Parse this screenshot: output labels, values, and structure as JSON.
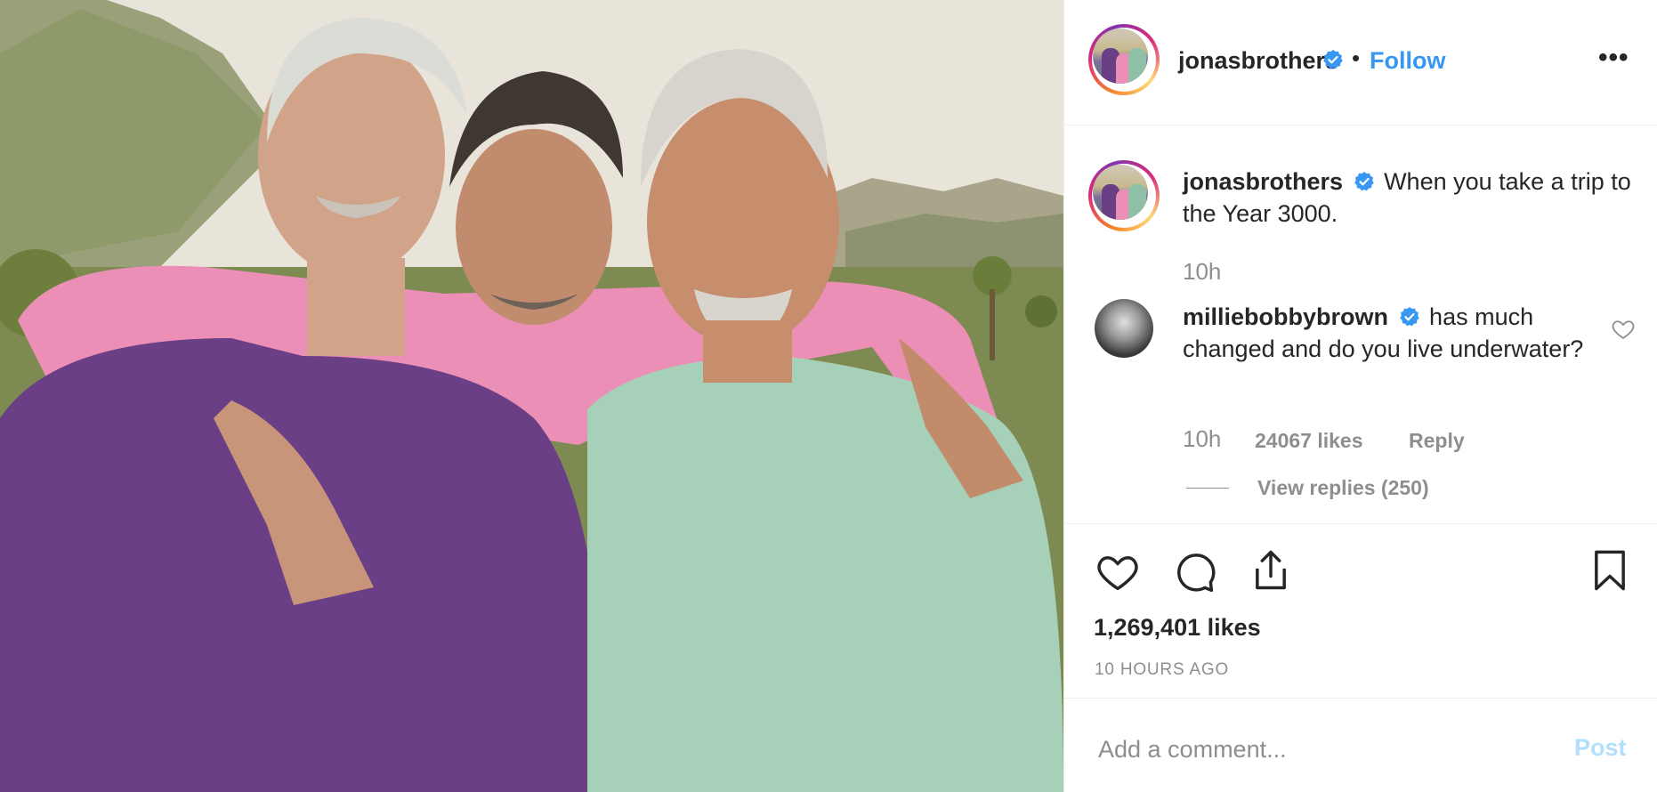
{
  "post": {
    "photo_alt": "Three men in sweaters outdoors",
    "header": {
      "username": "jonasbrothers",
      "separator": "•",
      "follow_label": "Follow",
      "more_label": "•••"
    },
    "caption": {
      "username": "jonasbrothers",
      "text": "When you take a trip to the Year 3000.",
      "time": "10h"
    },
    "comments": [
      {
        "username": "milliebobbybrown",
        "text": "has much changed and do you live underwater?",
        "time": "10h",
        "likes": "24067 likes",
        "reply_label": "Reply",
        "view_replies": "View replies (250)"
      }
    ],
    "likes": "1,269,401 likes",
    "time_ago": "10 HOURS AGO",
    "comment_box": {
      "placeholder": "Add a comment...",
      "post_label": "Post"
    }
  },
  "icons": {
    "verified": "verified-badge-icon",
    "like": "heart-icon",
    "comment": "comment-bubble-icon",
    "share": "share-icon",
    "save": "bookmark-icon",
    "more": "more-options-icon"
  },
  "colors": {
    "accent": "#3897f0",
    "text": "#262626",
    "muted": "#8e8e8e",
    "post_disabled": "#b2dffc"
  }
}
